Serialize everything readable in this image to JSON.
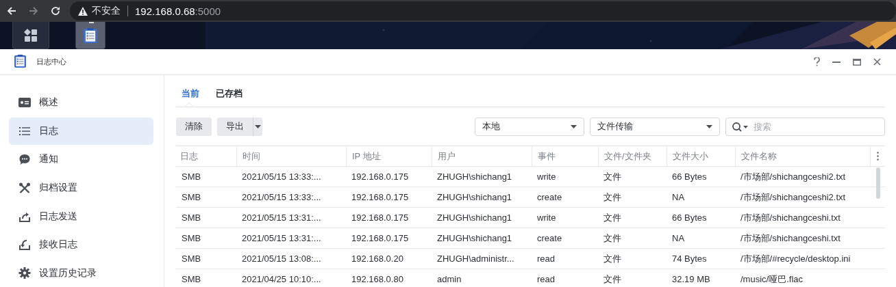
{
  "browser": {
    "security_label": "不安全",
    "url_host": "192.168.0.68",
    "url_port": ":5000"
  },
  "taskbar": {
    "items": [
      {
        "kind": "apps",
        "selected": false
      },
      {
        "kind": "log-center",
        "selected": true
      }
    ]
  },
  "window": {
    "title": "日志中心"
  },
  "sidebar": {
    "items": [
      {
        "label": "概述",
        "kind": "overview",
        "selected": false
      },
      {
        "label": "日志",
        "kind": "list",
        "selected": true
      },
      {
        "label": "通知",
        "kind": "chat",
        "selected": false
      },
      {
        "label": "归档设置",
        "kind": "tools",
        "selected": false
      },
      {
        "label": "日志发送",
        "kind": "send",
        "selected": false
      },
      {
        "label": "接收日志",
        "kind": "receive",
        "selected": false
      },
      {
        "label": "设置历史记录",
        "kind": "gear",
        "selected": false
      }
    ]
  },
  "tabs": [
    {
      "label": "当前",
      "selected": true
    },
    {
      "label": "已存档",
      "selected": false
    }
  ],
  "toolbar": {
    "buttons": [
      "清除",
      "导出"
    ],
    "source": "本地",
    "log_type": "文件传输",
    "search": {
      "placeholder": "搜索"
    }
  },
  "table": {
    "columns": [
      "日志",
      "时间",
      "IP 地址",
      "用户",
      "事件",
      "文件/文件夹",
      "文件大小",
      "文件名称"
    ],
    "rows": [
      [
        "SMB",
        "2021/05/15 13:33:...",
        "192.168.0.175",
        "ZHUGH\\shichang1",
        "write",
        "文件",
        "66 Bytes",
        "/市场部/shichangceshi2.txt"
      ],
      [
        "SMB",
        "2021/05/15 13:33:...",
        "192.168.0.175",
        "ZHUGH\\shichang1",
        "create",
        "文件",
        "NA",
        "/市场部/shichangceshi2.txt"
      ],
      [
        "SMB",
        "2021/05/15 13:31:...",
        "192.168.0.175",
        "ZHUGH\\shichang1",
        "write",
        "文件",
        "66 Bytes",
        "/市场部/shichangceshi.txt"
      ],
      [
        "SMB",
        "2021/05/15 13:31:...",
        "192.168.0.175",
        "ZHUGH\\shichang1",
        "create",
        "文件",
        "NA",
        "/市场部/shichangceshi.txt"
      ],
      [
        "SMB",
        "2021/05/15 13:08:...",
        "192.168.0.20",
        "ZHUGH\\administr...",
        "read",
        "文件",
        "74 Bytes",
        "/市场部/#recycle/desktop.ini"
      ],
      [
        "SMB",
        "2021/04/25 10:10:...",
        "192.168.0.80",
        "admin",
        "read",
        "文件",
        "32.19 MB",
        "/music/哑巴.flac"
      ]
    ]
  }
}
